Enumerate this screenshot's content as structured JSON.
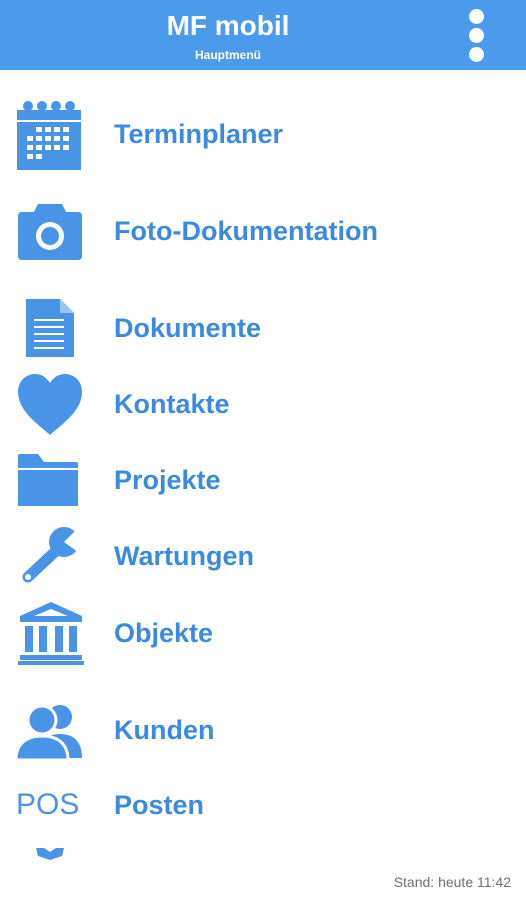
{
  "appbar": {
    "title": "MF mobil",
    "subtitle": "Hauptmenü",
    "overflow_icon": "more-vert-icon"
  },
  "colors": {
    "appbar": "#4c9aec",
    "accent": "#3a8be0",
    "icon": "#4a94e8",
    "status_text": "#707070"
  },
  "menu": [
    {
      "label": "Terminplaner",
      "icon": "calendar-icon"
    },
    {
      "label": "Foto-Dokumentation",
      "icon": "camera-icon"
    },
    {
      "label": "Dokumente",
      "icon": "document-icon"
    },
    {
      "label": "Kontakte",
      "icon": "heart-icon"
    },
    {
      "label": "Projekte",
      "icon": "folder-icon"
    },
    {
      "label": "Wartungen",
      "icon": "wrench-icon"
    },
    {
      "label": "Objekte",
      "icon": "building-icon"
    },
    {
      "label": "Kunden",
      "icon": "people-icon"
    },
    {
      "label": "Posten",
      "icon": "pos-icon",
      "icon_text": "POS"
    }
  ],
  "footer": {
    "status": "Stand: heute 11:42"
  }
}
